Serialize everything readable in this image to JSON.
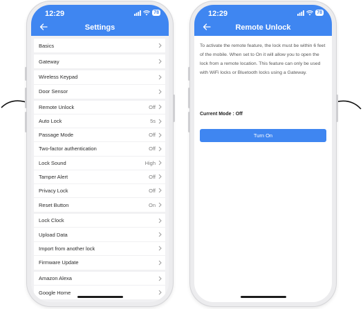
{
  "left_screen": {
    "time": "12:29",
    "battery": "78",
    "title": "Settings",
    "groups": [
      [
        {
          "label": "Basics",
          "value": ""
        }
      ],
      [
        {
          "label": "Gateway",
          "value": ""
        }
      ],
      [
        {
          "label": "Wireless Keypad",
          "value": ""
        },
        {
          "label": "Door Sensor",
          "value": ""
        }
      ],
      [
        {
          "label": "Remote Unlock",
          "value": "Off"
        },
        {
          "label": "Auto Lock",
          "value": "5s"
        },
        {
          "label": "Passage Mode",
          "value": "Off"
        },
        {
          "label": "Two-factor authentication",
          "value": "Off"
        },
        {
          "label": "Lock Sound",
          "value": "High"
        },
        {
          "label": "Tamper Alert",
          "value": "Off"
        },
        {
          "label": "Privacy Lock",
          "value": "Off"
        },
        {
          "label": "Reset Button",
          "value": "On"
        }
      ],
      [
        {
          "label": "Lock Clock",
          "value": ""
        },
        {
          "label": "Upload Data",
          "value": ""
        },
        {
          "label": "Import from another lock",
          "value": ""
        },
        {
          "label": "Firmware Update",
          "value": ""
        }
      ],
      [
        {
          "label": "Amazon Alexa",
          "value": ""
        },
        {
          "label": "Google Home",
          "value": ""
        }
      ]
    ]
  },
  "right_screen": {
    "time": "12:29",
    "battery": "78",
    "title": "Remote Unlock",
    "description": "To activate the remote feature, the lock must be within 6 feet of the mobile. When set to On it will allow you to open the lock from a remote location. This feature can only be used with WiFi locks or Bluetooth locks using a Gateway.",
    "current_mode_label": "Current Mode :",
    "current_mode_value": "Off",
    "button_label": "Turn On"
  },
  "colors": {
    "accent": "#3f86f1",
    "background": "#f1f1f3",
    "phone_frame": "#ececee"
  },
  "icons": [
    "back-arrow-icon",
    "chevron-right-icon",
    "wifi-icon",
    "signal-icon",
    "battery-icon",
    "pointer-arrow-icon"
  ]
}
